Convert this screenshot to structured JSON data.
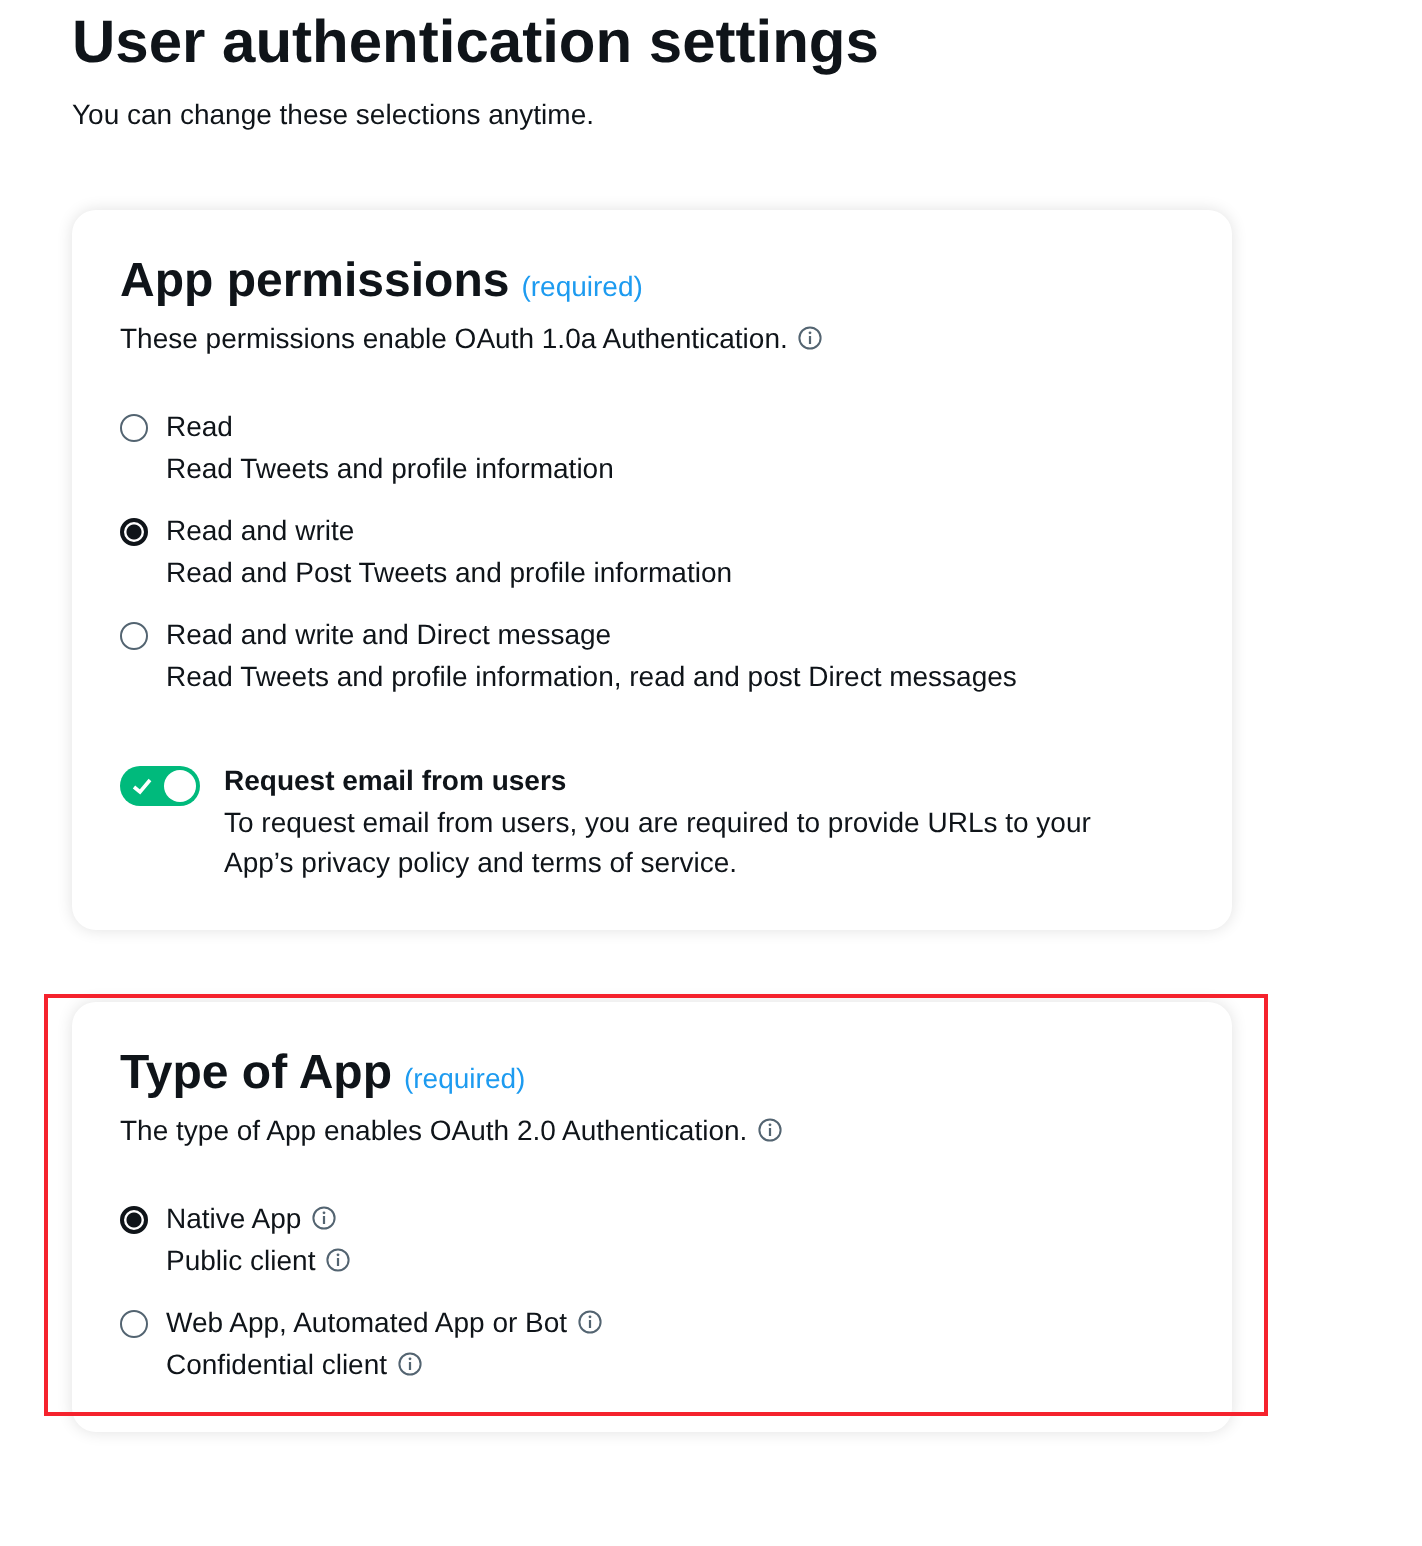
{
  "page": {
    "title": "User authentication settings",
    "subtitle": "You can change these selections anytime."
  },
  "sections": [
    {
      "title": "App permissions",
      "required": "(required)",
      "description": "These permissions enable OAuth 1.0a Authentication.",
      "info": true,
      "highlighted": false,
      "options": [
        {
          "label": "Read",
          "sublabel": "Read Tweets and profile information",
          "selected": false,
          "info": false,
          "sub_info": false
        },
        {
          "label": "Read and write",
          "sublabel": "Read and Post Tweets and profile information",
          "selected": true,
          "info": false,
          "sub_info": false
        },
        {
          "label": "Read and write and Direct message",
          "sublabel": "Read Tweets and profile information, read and post Direct messages",
          "selected": false,
          "info": false,
          "sub_info": false
        }
      ],
      "toggle": {
        "label": "Request email from users",
        "description": "To request email from users, you are required to provide URLs to your App’s privacy policy and terms of service.",
        "on": true
      }
    },
    {
      "title": "Type of App",
      "required": "(required)",
      "description": "The type of App enables OAuth 2.0 Authentication.",
      "info": true,
      "highlighted": true,
      "options": [
        {
          "label": "Native App",
          "sublabel": "Public client",
          "selected": true,
          "info": true,
          "sub_info": true
        },
        {
          "label": "Web App, Automated App or Bot",
          "sublabel": "Confidential client",
          "selected": false,
          "info": true,
          "sub_info": true
        }
      ]
    }
  ]
}
